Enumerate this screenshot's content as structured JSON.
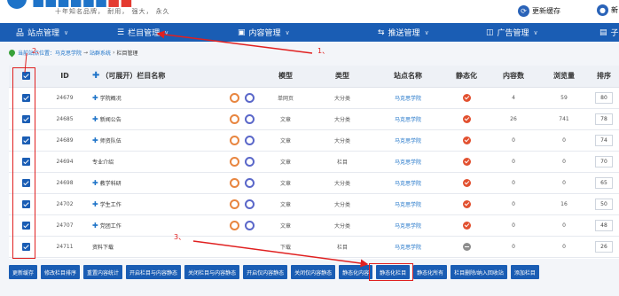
{
  "header": {
    "logo_title_main": "■■■■■■",
    "logo_title_accent": "■■",
    "slogan": "十年知名品牌， 耐用， 强大， 永久",
    "refresh_label": "更新缓存",
    "refresh_icon": "refresh-icon",
    "user_initial": "新",
    "user_icon": "user-icon"
  },
  "nav": {
    "items": [
      {
        "icon": "sitemap-icon",
        "glyph": "品",
        "label": "站点管理"
      },
      {
        "icon": "list-icon",
        "glyph": "☰",
        "label": "栏目管理"
      },
      {
        "icon": "content-icon",
        "glyph": "▣",
        "label": "内容管理"
      },
      {
        "icon": "push-icon",
        "glyph": "⇆",
        "label": "推送管理"
      },
      {
        "icon": "ad-icon",
        "glyph": "◫",
        "label": "广告管理"
      },
      {
        "icon": "subsite-icon",
        "glyph": "▤",
        "label": "子站设置"
      }
    ]
  },
  "breadcrumb": {
    "label": "当前站点位置：马克思学院",
    "sep": "→",
    "system": "站群系统",
    "sep2": "›",
    "current": "栏目管理"
  },
  "table": {
    "headers": {
      "id": "ID",
      "name": "（可展开）栏目名称",
      "model": "模型",
      "type": "类型",
      "site": "站点名称",
      "static": "静态化",
      "count": "内容数",
      "views": "浏览量",
      "sort": "排序"
    },
    "rows": [
      {
        "id": "24679",
        "name": "学院概况",
        "expand": true,
        "has_ops": true,
        "model": "单网页",
        "type": "大分类",
        "site": "马克思学院",
        "static": "yes",
        "count": "4",
        "views": "59",
        "sort": "80"
      },
      {
        "id": "24685",
        "name": "新闻公告",
        "expand": true,
        "has_ops": true,
        "model": "文章",
        "type": "大分类",
        "site": "马克思学院",
        "static": "yes",
        "count": "26",
        "views": "741",
        "sort": "78"
      },
      {
        "id": "24689",
        "name": "师资队伍",
        "expand": true,
        "has_ops": true,
        "model": "文章",
        "type": "大分类",
        "site": "马克思学院",
        "static": "yes",
        "count": "0",
        "views": "0",
        "sort": "74"
      },
      {
        "id": "24694",
        "name": "专业介绍",
        "expand": false,
        "has_ops": true,
        "model": "文章",
        "type": "栏目",
        "site": "马克思学院",
        "static": "yes",
        "count": "0",
        "views": "0",
        "sort": "70"
      },
      {
        "id": "24698",
        "name": "教学科研",
        "expand": true,
        "has_ops": true,
        "model": "文章",
        "type": "大分类",
        "site": "马克思学院",
        "static": "yes",
        "count": "0",
        "views": "0",
        "sort": "65"
      },
      {
        "id": "24702",
        "name": "学生工作",
        "expand": true,
        "has_ops": true,
        "model": "文章",
        "type": "大分类",
        "site": "马克思学院",
        "static": "yes",
        "count": "0",
        "views": "16",
        "sort": "50"
      },
      {
        "id": "24707",
        "name": "党团工作",
        "expand": true,
        "has_ops": true,
        "model": "文章",
        "type": "大分类",
        "site": "马克思学院",
        "static": "yes",
        "count": "0",
        "views": "0",
        "sort": "48"
      },
      {
        "id": "24711",
        "name": "资料下载",
        "expand": false,
        "has_ops": false,
        "model": "下载",
        "type": "栏目",
        "site": "马克思学院",
        "static": "no",
        "count": "0",
        "views": "0",
        "sort": "26"
      }
    ]
  },
  "buttons": [
    "更新缓存",
    "修改栏目排序",
    "重置内容统计",
    "开启栏目与内容静态",
    "关闭栏目与内容静态",
    "开启仅内容静态",
    "关闭仅内容静态",
    "静态化内容",
    "静态化栏目",
    "静态化所有",
    "栏目删除/纳入回收站",
    "添加栏目"
  ],
  "annotations": {
    "step1": "1、",
    "step2": "2、",
    "step3": "3、",
    "color": "#e02020"
  },
  "colors": {
    "brand": "#1a5db4",
    "static_on": "#e2502f",
    "static_off": "#8d8d8d"
  }
}
